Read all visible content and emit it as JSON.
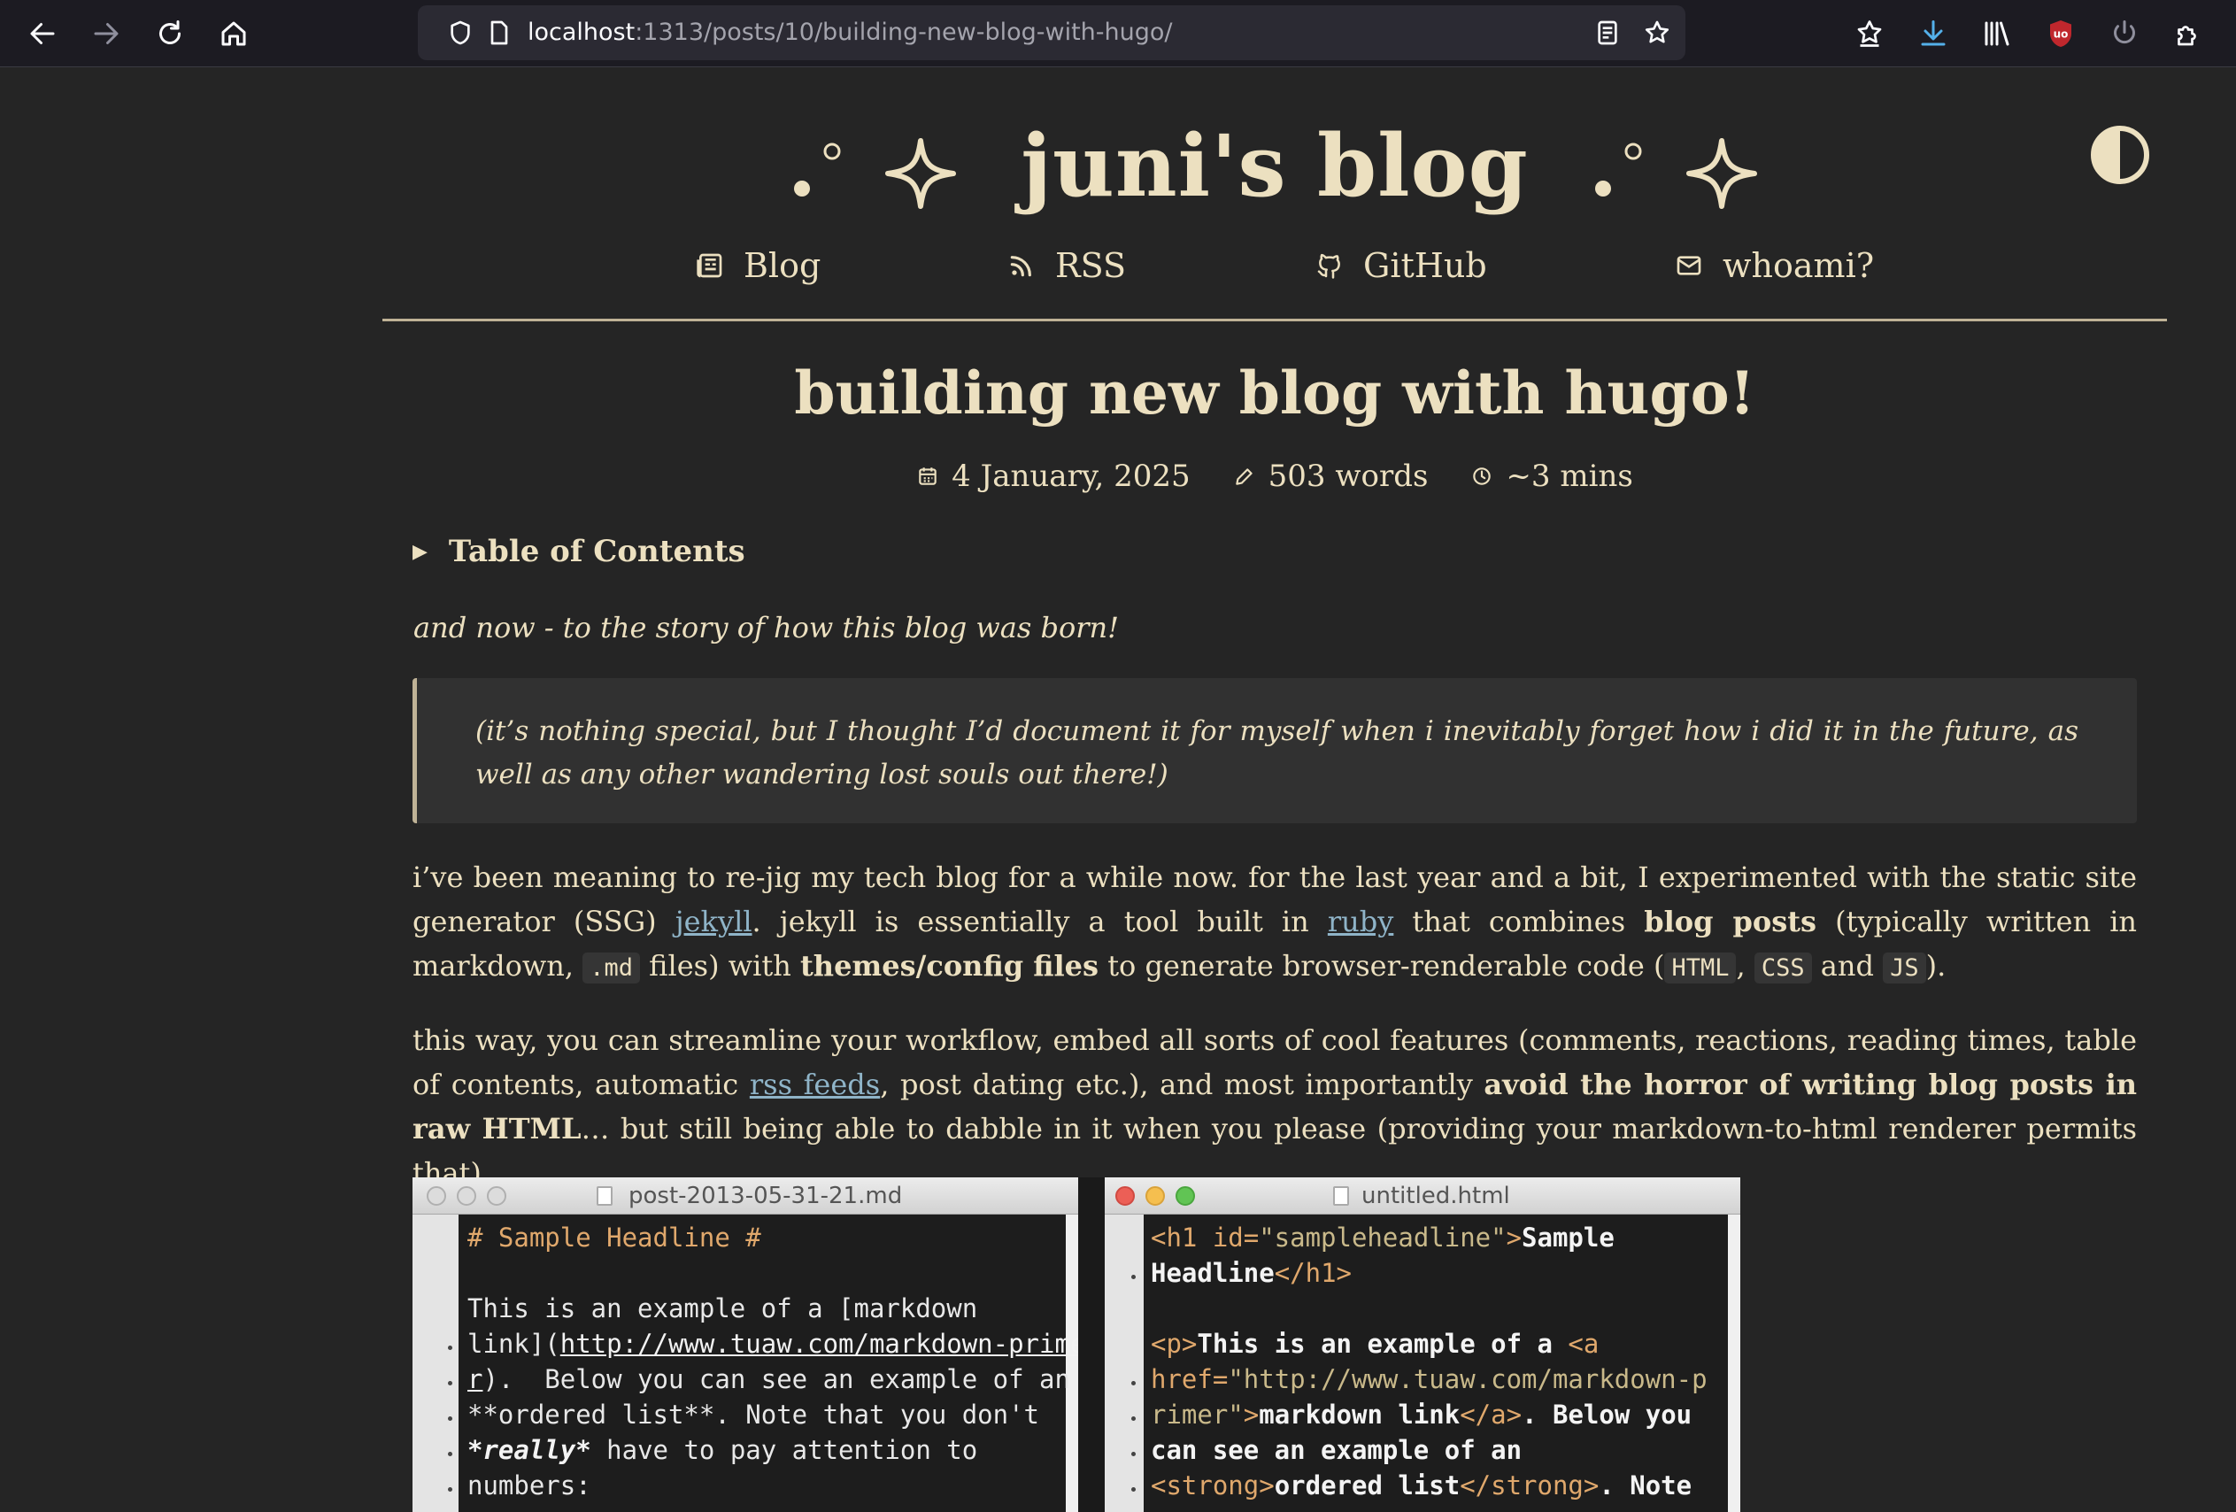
{
  "browser": {
    "url_host": "localhost",
    "url_path": ":1313/posts/10/building-new-blog-with-hugo/"
  },
  "site": {
    "title": "juni's blog",
    "nav": [
      {
        "label": "Blog",
        "icon": "newspaper-icon"
      },
      {
        "label": "RSS",
        "icon": "rss-icon"
      },
      {
        "label": "GitHub",
        "icon": "github-icon"
      },
      {
        "label": "whoami?",
        "icon": "mail-icon"
      }
    ]
  },
  "post": {
    "title": "building new blog with hugo!",
    "date": "4 January, 2025",
    "words": "503 words",
    "read_time": "~3 mins",
    "toc_label": "Table of Contents",
    "intro": "and now - to the story of how this blog was born!",
    "quote": "(it’s nothing special, but I thought I’d document it for myself when i inevitably forget how i did it in the future, as well as any other wandering lost souls out there!)",
    "p1": {
      "t1": "i’ve been meaning to re-jig my tech blog for a while now. for the last year and a bit, I experimented with the static site generator (SSG) ",
      "link_jekyll": "jekyll",
      "t2": ". jekyll is essentially a tool built in ",
      "link_ruby": "ruby",
      "t3": " that combines ",
      "b1": "blog posts",
      "t4": " (typically written in markdown, ",
      "code_md": ".md",
      "t5": " files) with ",
      "b2": "themes/config files",
      "t6": " to generate browser-renderable code (",
      "code_html": "HTML",
      "t7": ", ",
      "code_css": "CSS",
      "t8": " and ",
      "code_js": "JS",
      "t9": ")."
    },
    "p2": {
      "t1": "this way, you can streamline your workflow, embed all sorts of cool features (comments, reactions, reading times, table of contents, automatic ",
      "link_rss": "rss feeds",
      "t2": ", post dating etc.), and most importantly ",
      "b1": "avoid the horror of writing blog posts in raw HTML",
      "t3": "… but still being able to dabble in it when you please (providing your markdown-to-html renderer permits that)."
    },
    "screenshot": {
      "left_title": "post-2013-05-31-21.md",
      "right_title": "untitled.html",
      "left_lines": {
        "l1": "# Sample Headline #",
        "l3a": "This is an example of a [markdown",
        "l4a": "link](",
        "l4b": "http://www.tuaw.com/markdown-prime",
        "l5a": "r",
        "l5b": ").  Below you can see an example of an",
        "l6": "**ordered list**. Note that you don't",
        "l7a": "*really*",
        "l7b": " have to pay attention to",
        "l8": "numbers:"
      },
      "right_lines": {
        "l1a": "<h1 id=",
        "l1b": "\"sampleheadline\"",
        "l1c": ">",
        "l1d": "Sample",
        "l2a": "Headline",
        "l2b": "</h1>",
        "l4a": "<p>",
        "l4b": "This is an example of a ",
        "l4c": "<a",
        "l5a": "href=",
        "l5b": "\"http://www.tuaw.com/markdown-p",
        "l6a": "rimer\"",
        "l6b": ">",
        "l6c": "markdown link",
        "l6d": "</a>",
        "l6e": ". Below you",
        "l7": "can see an example of an",
        "l8a": "<strong>",
        "l8b": "ordered list",
        "l8c": "</strong>",
        "l8d": ". Note"
      }
    }
  },
  "colors": {
    "page_bg": "#252525",
    "text": "#ece0c0",
    "link": "#8fb4c8",
    "toolbar_bg": "#1c1b22",
    "download_accent": "#54b0ea",
    "ublock_red": "#c0272d"
  }
}
